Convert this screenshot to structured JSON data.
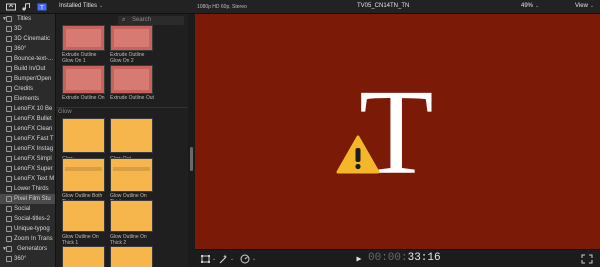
{
  "toolbar": {
    "dropdown_label": "Installed Titles",
    "format_label": "1080p HD 60p, Stereo",
    "project_name": "TV05_CN14TN_TN",
    "zoom_label": "49%",
    "view_label": "View"
  },
  "search": {
    "placeholder": "Search"
  },
  "sidebar": {
    "items": [
      {
        "label": "Titles",
        "type": "header"
      },
      {
        "label": "3D"
      },
      {
        "label": "3D Cinematic"
      },
      {
        "label": "360°"
      },
      {
        "label": "Bounce-text-..."
      },
      {
        "label": "Build In/Out"
      },
      {
        "label": "Bumper/Open"
      },
      {
        "label": "Credits"
      },
      {
        "label": "Elements"
      },
      {
        "label": "LenoFX 10 Be"
      },
      {
        "label": "LenoFX Bullet"
      },
      {
        "label": "LenoFX Clean"
      },
      {
        "label": "LenoFX Fast T"
      },
      {
        "label": "LenoFX Instag"
      },
      {
        "label": "LenoFX Simpl"
      },
      {
        "label": "LenoFX Super"
      },
      {
        "label": "LenoFX Text M"
      },
      {
        "label": "Lower Thirds"
      },
      {
        "label": "Pixel Film Stu",
        "selected": true
      },
      {
        "label": "Social"
      },
      {
        "label": "Social-titles-2"
      },
      {
        "label": "Unique-typog"
      },
      {
        "label": "Zoom In Trans"
      },
      {
        "label": "Generators",
        "type": "header"
      },
      {
        "label": "360°"
      }
    ]
  },
  "browser": {
    "top_captions": [
      "Extrude Outline Glow On 1",
      "Extrude Outline Glow On 2"
    ],
    "second_captions": [
      "Extrude Outline On",
      "Extrude Outline Out"
    ],
    "section_label": "Glow",
    "glow_captions": [
      "Glow",
      "Glow Out",
      "Glow Outline Both Thick",
      "Glow Outline On Thick",
      "Glow Outline On Thick 1",
      "Glow Outline On Thick 2"
    ]
  },
  "viewer": {
    "title_glyph": "T"
  },
  "timecode": {
    "prefix": "00:00:",
    "value": "33:16"
  },
  "colors": {
    "viewer_bg": "#7b1a06",
    "thumb_red": "#c8625c",
    "thumb_gold": "#f7b64c",
    "warning": "#f5b72a"
  }
}
